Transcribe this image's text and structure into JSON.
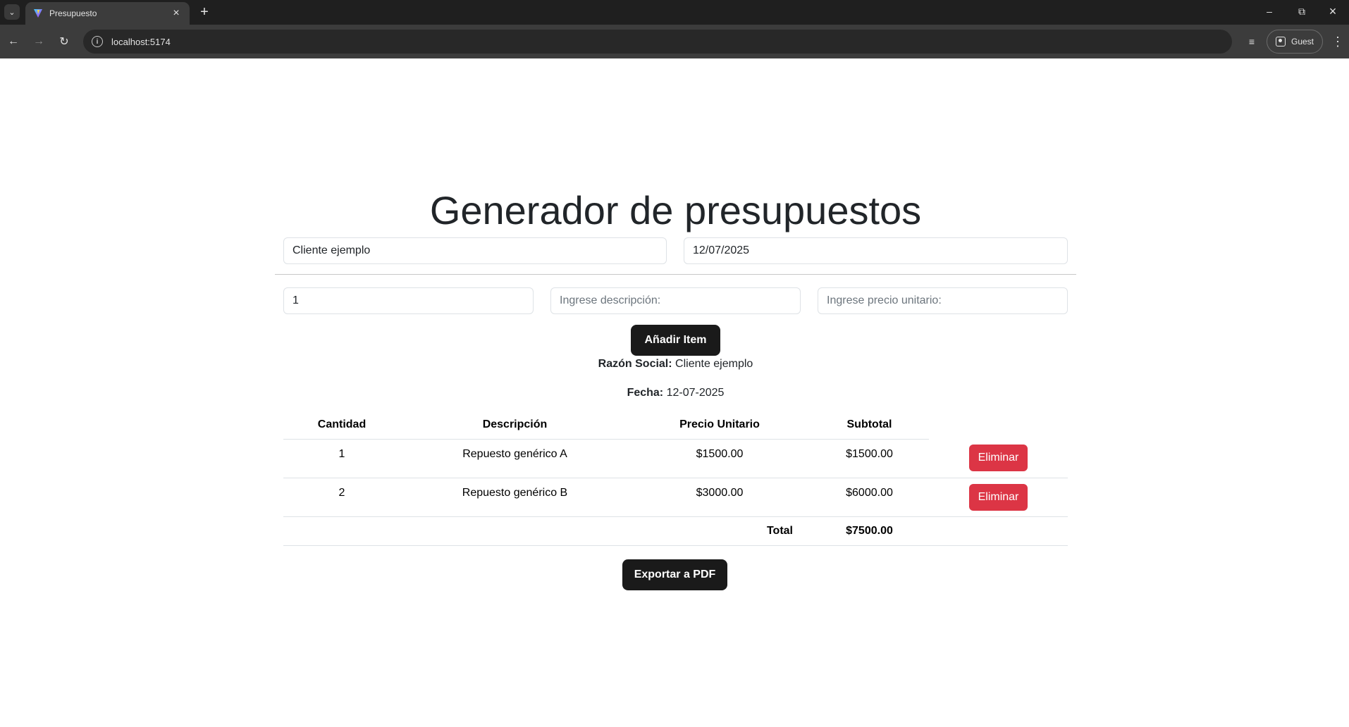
{
  "browser": {
    "tab_title": "Presupuesto",
    "url": "localhost:5174",
    "profile_label": "Guest"
  },
  "app": {
    "title": "Generador de presupuestos",
    "client_input": {
      "value": "Cliente ejemplo"
    },
    "date_input": {
      "value": "12/07/2025"
    },
    "quantity_input": {
      "value": "1"
    },
    "description_input": {
      "placeholder": "Ingrese descripción:"
    },
    "price_input": {
      "placeholder": "Ingrese precio unitario:"
    },
    "add_button": "Añadir Item",
    "razon_social_label": "Razón Social:",
    "razon_social_value": "Cliente ejemplo",
    "fecha_label": "Fecha:",
    "fecha_value": "12-07-2025",
    "table": {
      "headers": [
        "Cantidad",
        "Descripción",
        "Precio Unitario",
        "Subtotal"
      ],
      "rows": [
        {
          "cantidad": "1",
          "descripcion": "Repuesto genérico A",
          "precio": "$1500.00",
          "subtotal": "$1500.00",
          "action": "Eliminar"
        },
        {
          "cantidad": "2",
          "descripcion": "Repuesto genérico B",
          "precio": "$3000.00",
          "subtotal": "$6000.00",
          "action": "Eliminar"
        }
      ],
      "total_label": "Total",
      "total_value": "$7500.00"
    },
    "export_button": "Exportar a PDF"
  },
  "colors": {
    "danger": "#dc3545",
    "dark_button": "#1a1a1a"
  }
}
